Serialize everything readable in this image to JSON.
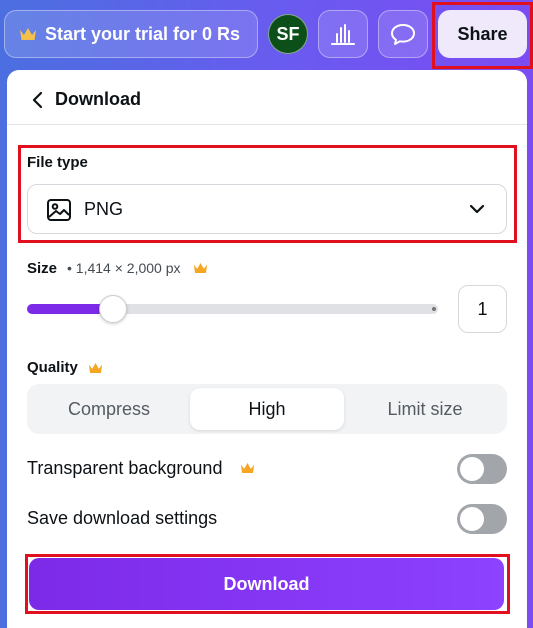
{
  "topbar": {
    "trial_label": "Start your trial for 0 Rs",
    "avatar_initials": "SF",
    "share_label": "Share"
  },
  "panel": {
    "title": "Download"
  },
  "file_type": {
    "label": "File type",
    "selected": "PNG"
  },
  "size": {
    "label": "Size",
    "dimensions": "• 1,414 × 2,000 px",
    "scale_value": "1",
    "slider_fraction": 0.21
  },
  "quality": {
    "label": "Quality",
    "options": [
      "Compress",
      "High",
      "Limit size"
    ],
    "selected": "High"
  },
  "toggles": {
    "transparent_label": "Transparent background",
    "transparent_on": false,
    "save_settings_label": "Save download settings",
    "save_settings_on": false
  },
  "download_label": "Download",
  "colors": {
    "accent": "#7d2ae8",
    "premium_crown": "#f5a623",
    "highlight": "#e0101e",
    "avatar_bg": "#0c4f18"
  },
  "icons": [
    "crown-icon",
    "chart-icon",
    "comment-icon",
    "chevron-left-icon",
    "image-icon",
    "chevron-down-icon"
  ]
}
